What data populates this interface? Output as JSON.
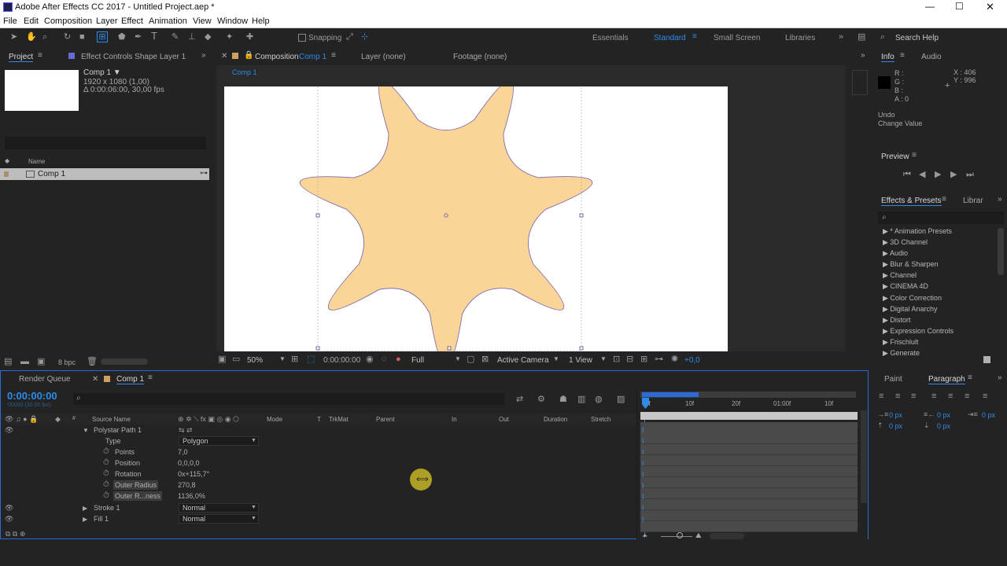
{
  "window": {
    "title": "Adobe After Effects CC 2017 - Untitled Project.aep *"
  },
  "menu": [
    "File",
    "Edit",
    "Composition",
    "Layer",
    "Effect",
    "Animation",
    "View",
    "Window",
    "Help"
  ],
  "toolbar": {
    "snapping": "Snapping"
  },
  "workspaces": [
    "Essentials",
    "Standard",
    "Small Screen",
    "Libraries"
  ],
  "search_help": "Search Help",
  "project": {
    "tab": "Project",
    "effect_controls_tab": "Effect Controls Shape Layer 1",
    "item_name": "Comp 1 ▼",
    "item_size": "1920 x 1080 (1,00)",
    "item_duration": "Δ 0:00:06:00, 30,00 fps",
    "col_name": "Name",
    "rows": [
      "Comp 1"
    ],
    "bpc": "8 bpc"
  },
  "comp": {
    "tab_prefix": "Composition",
    "tab_name": "Comp 1",
    "layer_tab": "Layer (none)",
    "footage_tab": "Footage (none)",
    "breadcrumb": "Comp 1",
    "zoom": "50%",
    "timecode": "0:00:00:00",
    "resolution": "Full",
    "camera": "Active Camera",
    "views": "1 View",
    "exposure": "+0,0"
  },
  "info": {
    "tab": "Info",
    "audio_tab": "Audio",
    "r": "R :",
    "g": "G :",
    "b": "B :",
    "a": "A : 0",
    "x": "X : 406",
    "y": "Y : 996",
    "undo": "Undo",
    "change": "Change Value"
  },
  "preview": {
    "tab": "Preview"
  },
  "effects": {
    "tab": "Effects & Presets",
    "lib_tab": "Librar",
    "items": [
      "* Animation Presets",
      "3D Channel",
      "Audio",
      "Blur & Sharpen",
      "Channel",
      "CINEMA 4D",
      "Color Correction",
      "Digital Anarchy",
      "Distort",
      "Expression Controls",
      "Frischlult",
      "Generate"
    ]
  },
  "timeline": {
    "render_tab": "Render Queue",
    "comp_tab": "Comp 1",
    "timecode": "0:00:00:00",
    "frames": "00000 (30.00 fps)",
    "columns": [
      "Source Name",
      "Mode",
      "T",
      "TrkMat",
      "Parent",
      "In",
      "Out",
      "Duration",
      "Stretch"
    ],
    "ruler": [
      "0f",
      "10f",
      "20f",
      "01:00f",
      "10f"
    ],
    "rows": [
      {
        "label": "Polystar Path 1",
        "value": ""
      },
      {
        "label": "Type",
        "value": "Polygon"
      },
      {
        "label": "Points",
        "value": "7,0"
      },
      {
        "label": "Position",
        "value": "0,0,0,0"
      },
      {
        "label": "Rotation",
        "value": "0x+115,7°"
      },
      {
        "label": "Outer Radius",
        "value": "270,8"
      },
      {
        "label": "Outer R...ness",
        "value": "1136,0%"
      },
      {
        "label": "Stroke 1",
        "value": "Normal"
      },
      {
        "label": "Fill 1",
        "value": "Normal"
      }
    ]
  },
  "paragraph": {
    "paint_tab": "Paint",
    "para_tab": "Paragraph",
    "px": "0 px"
  }
}
